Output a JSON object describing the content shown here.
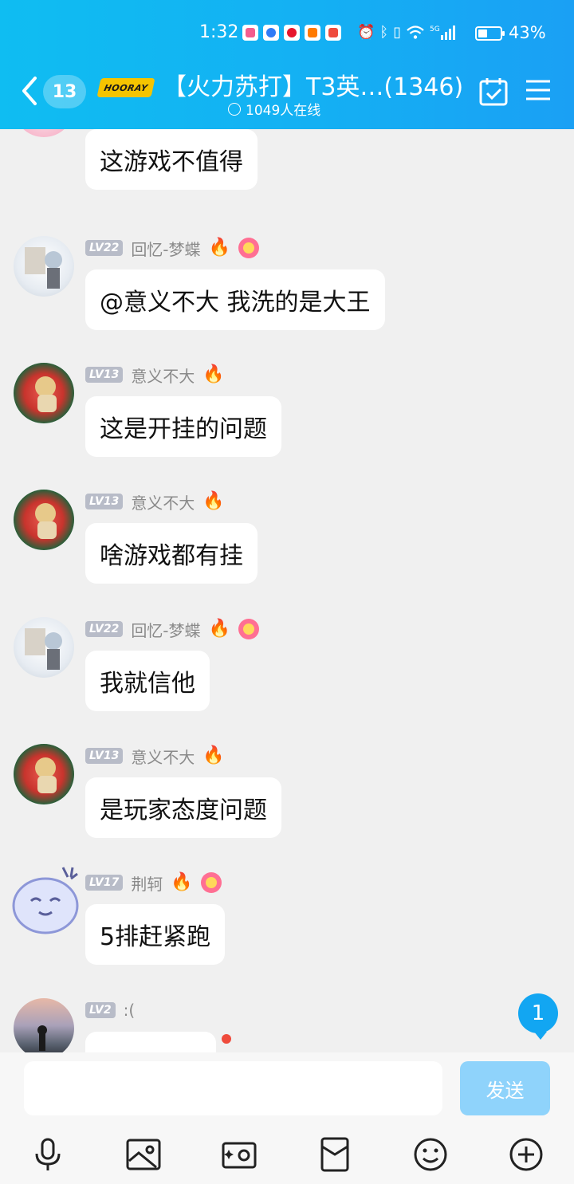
{
  "status_bar": {
    "time": "1:32",
    "battery_percent": "43%",
    "battery_level": 0.43,
    "notification_icons": [
      "bilibili-icon",
      "browser-icon",
      "weibo-icon",
      "video-icon",
      "app-icon"
    ],
    "system_icons": [
      "alarm-icon",
      "bluetooth-icon",
      "vibrate-icon",
      "wifi-icon",
      "5g-signal-icon"
    ]
  },
  "header": {
    "unread_count": "13",
    "logo_text": "HOORAY",
    "title": "【火力苏打】T3英…(1346)",
    "online_text": "1049人在线"
  },
  "messages": [
    {
      "user": "",
      "level": "",
      "badges": [],
      "text": "这游戏不值得",
      "avatar": "pink-hair-girl-avatar"
    },
    {
      "user": "回忆-梦蝶",
      "level": "LV22",
      "badges": [
        "fire",
        "flower"
      ],
      "text": "@意义不大 我洗的是大王",
      "avatar": "white-hair-character-avatar"
    },
    {
      "user": "意义不大",
      "level": "LV13",
      "badges": [
        "fire"
      ],
      "text": "这是开挂的问题",
      "avatar": "watermelon-character-avatar"
    },
    {
      "user": "意义不大",
      "level": "LV13",
      "badges": [
        "fire"
      ],
      "text": "啥游戏都有挂",
      "avatar": "watermelon-character-avatar"
    },
    {
      "user": "回忆-梦蝶",
      "level": "LV22",
      "badges": [
        "fire",
        "flower"
      ],
      "text": "我就信他",
      "avatar": "white-hair-character-avatar"
    },
    {
      "user": "意义不大",
      "level": "LV13",
      "badges": [
        "fire"
      ],
      "text": "是玩家态度问题",
      "avatar": "watermelon-character-avatar"
    },
    {
      "user": "荆轲",
      "level": "LV17",
      "badges": [
        "fire",
        "flower"
      ],
      "text": "5排赶紧跑",
      "avatar": "blue-blob-sticker-avatar"
    },
    {
      "user": ":(",
      "level": "LV2",
      "badges": [],
      "text": "",
      "avatar": "sunset-silhouette-avatar"
    }
  ],
  "floating_unread": "1",
  "input": {
    "value": "",
    "placeholder": ""
  },
  "send_label": "发送",
  "toolbar_icons": [
    "microphone-icon",
    "image-icon",
    "camera-icon",
    "red-packet-icon",
    "emoji-icon",
    "plus-icon"
  ],
  "colors": {
    "header_gradient_start": "#0fbdf2",
    "header_gradient_end": "#1aa0f4",
    "send_button": "#8fd3fb",
    "level_badge": "#b8bcc8",
    "unread_badge": "#12a6f2",
    "chat_background": "#f0f0f0"
  }
}
